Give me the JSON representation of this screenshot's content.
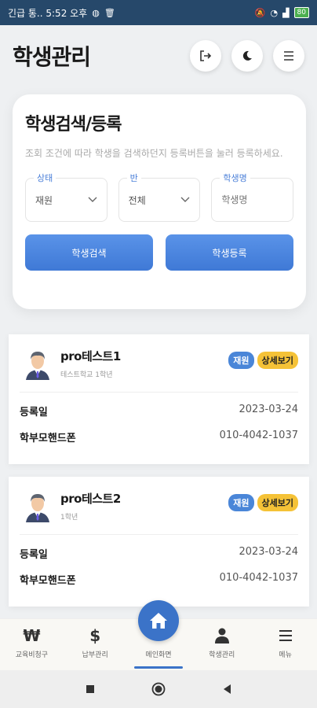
{
  "status_bar": {
    "left_text": "긴급 통.. 5:52 오후",
    "icons": [
      "message-icon",
      "trash-icon"
    ],
    "right_text": "...",
    "battery": "80"
  },
  "header": {
    "title": "학생관리",
    "buttons": [
      "logout-icon",
      "moon-icon",
      "menu-icon"
    ]
  },
  "search": {
    "title": "학생검색/등록",
    "description": "조회 조건에 따라 학생을 검색하던지 등록버튼을 눌러 등록하세요.",
    "status_label": "상태",
    "status_value": "재원",
    "class_label": "반",
    "class_value": "전체",
    "name_label": "학생명",
    "name_placeholder": "학생명",
    "search_button": "학생검색",
    "register_button": "학생등록"
  },
  "students": [
    {
      "name": "pro테스트1",
      "school": "테스트학교 1학년",
      "status_badge": "재원",
      "detail_button": "상세보기",
      "reg_label": "등록일",
      "reg_date": "2023-03-24",
      "phone_label": "학부모핸드폰",
      "phone": "010-4042-1037"
    },
    {
      "name": "pro테스트2",
      "school": "1학년",
      "status_badge": "재원",
      "detail_button": "상세보기",
      "reg_label": "등록일",
      "reg_date": "2023-03-24",
      "phone_label": "학부모핸드폰",
      "phone": "010-4042-1037"
    }
  ],
  "bottom_nav": {
    "items": [
      {
        "label": "교육비청구",
        "icon": "won-icon",
        "glyph": "₩"
      },
      {
        "label": "납부관리",
        "icon": "dollar-icon",
        "glyph": "$"
      },
      {
        "label": "메인화면",
        "icon": "home-icon"
      },
      {
        "label": "학생관리",
        "icon": "person-icon"
      },
      {
        "label": "메뉴",
        "icon": "menu-icon"
      }
    ],
    "active": "메인화면"
  },
  "colors": {
    "primary": "#3b73c8",
    "accent_yellow": "#f5c237",
    "statusbar": "#26486a"
  }
}
